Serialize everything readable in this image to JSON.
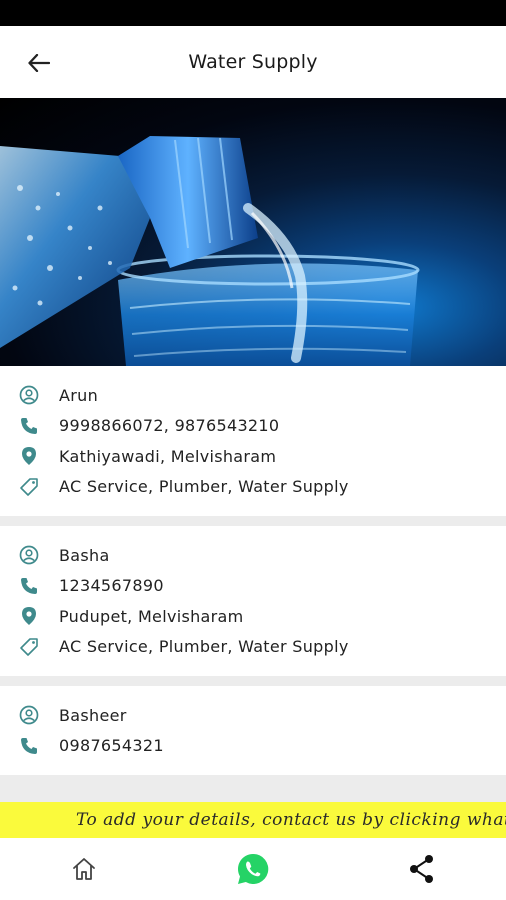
{
  "header": {
    "title": "Water Supply",
    "back_icon": "arrow-left-icon"
  },
  "hero": {
    "description_icon": "water-bottle-pouring-image"
  },
  "icons": {
    "person": "person-circle-icon",
    "phone": "phone-icon",
    "location": "location-pin-icon",
    "tag": "tag-icon"
  },
  "contacts": [
    {
      "name": "Arun",
      "phone": "9998866072, 9876543210",
      "location": "Kathiyawadi, Melvisharam",
      "services": "AC Service, Plumber, Water Supply"
    },
    {
      "name": "Basha",
      "phone": "1234567890",
      "location": "Pudupet, Melvisharam",
      "services": "AC Service, Plumber, Water Supply"
    },
    {
      "name": "Basheer",
      "phone": "0987654321"
    }
  ],
  "ticker": {
    "text": "To add your details, contact us by clicking whatsapp"
  },
  "bottom_nav": {
    "home_icon": "home-icon",
    "whatsapp_icon": "whatsapp-icon",
    "share_icon": "share-icon"
  },
  "colors": {
    "icon_teal": "#3f8a8c",
    "ticker_bg": "#fafa3c",
    "whatsapp_green": "#25d366",
    "divider": "#ececec"
  }
}
